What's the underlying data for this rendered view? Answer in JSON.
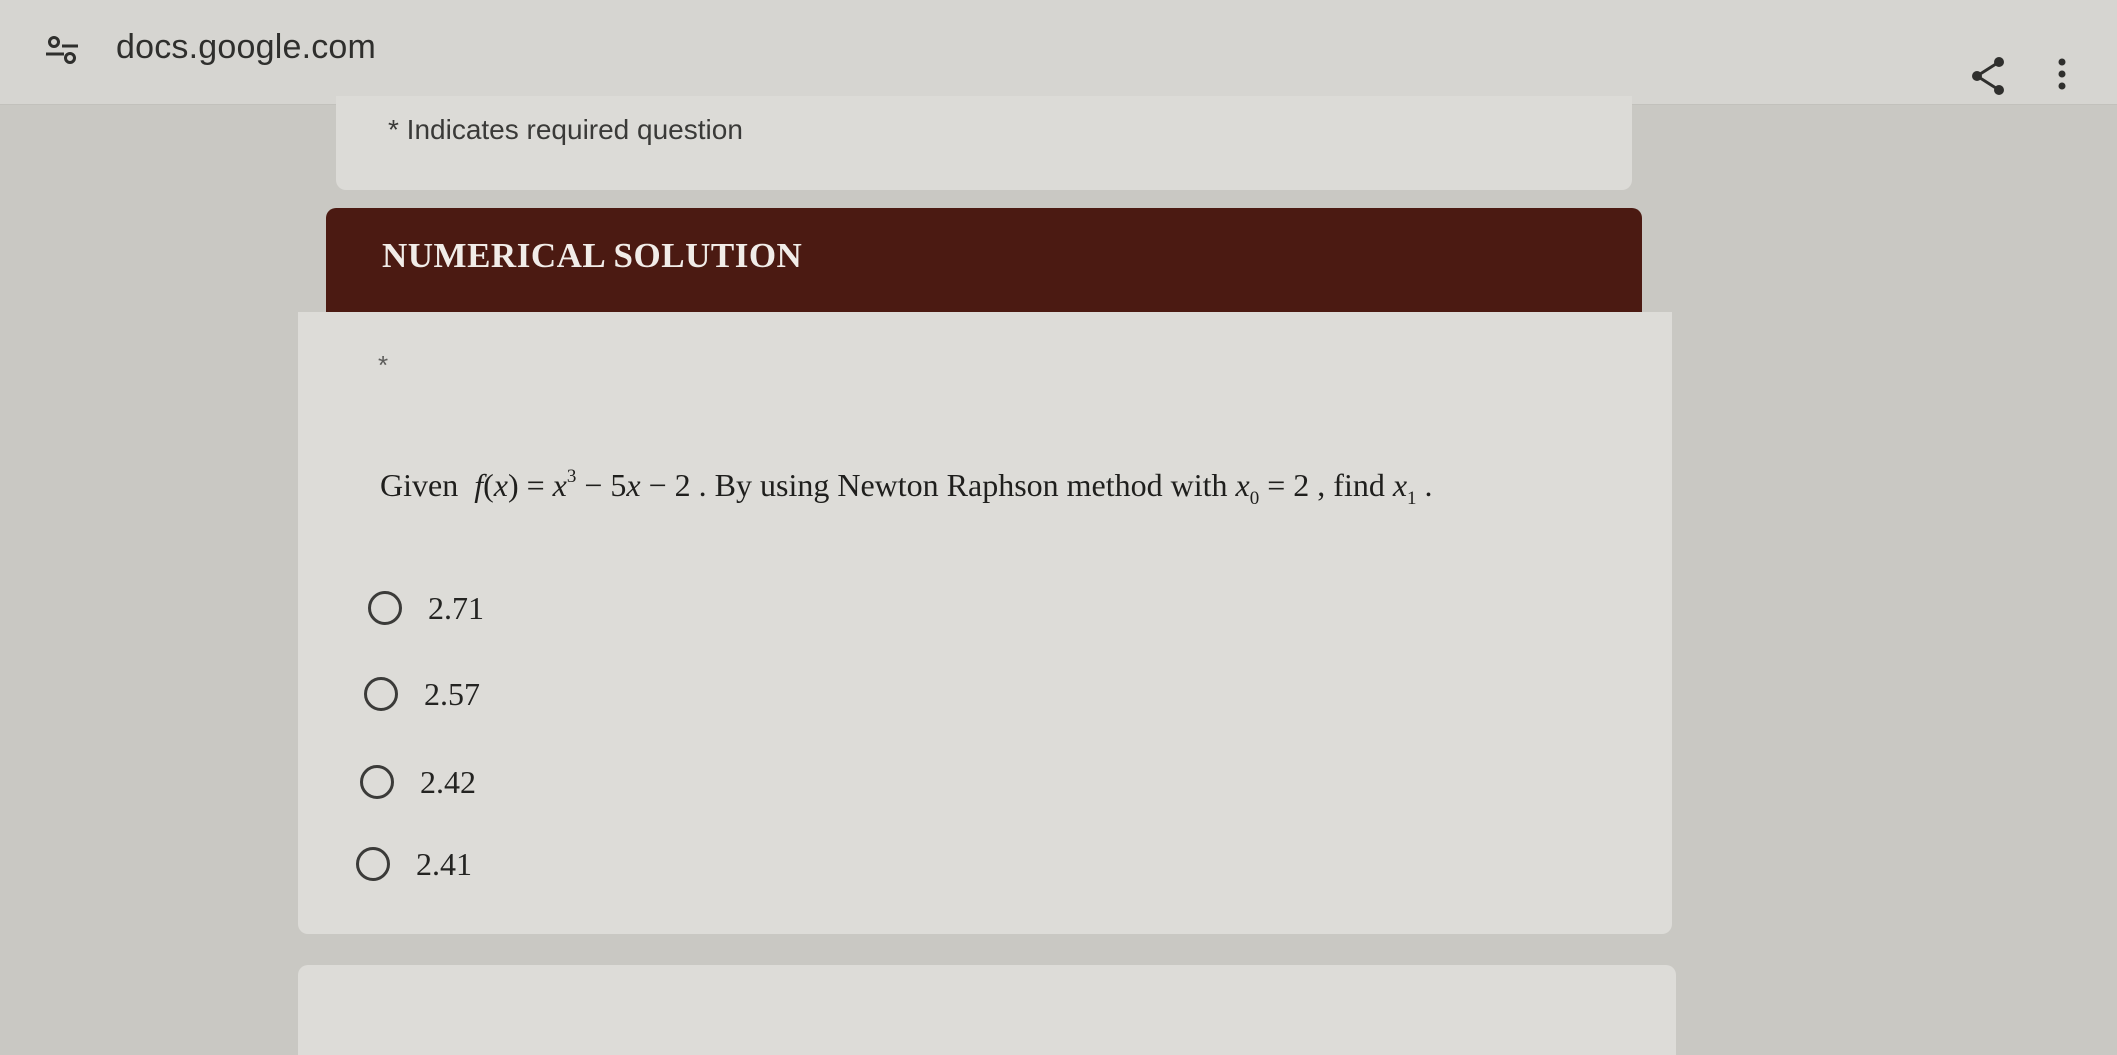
{
  "browser": {
    "url": "docs.google.com",
    "site_info_icon": "site-info-tune-icon",
    "share_icon": "share-icon",
    "menu_icon": "more-vert-icon"
  },
  "form": {
    "required_note": "* Indicates required question",
    "section_title": "NUMERICAL SOLUTION",
    "question": {
      "required_marker": "*",
      "text_prefix": "Given",
      "fx_f": "f",
      "fx_open": "(",
      "fx_x": "x",
      "fx_close": ")",
      "fx_eq": " = ",
      "fx_x3": "x",
      "fx_exp": "3",
      "fx_rest_minus": " − 5",
      "fx_rest_x": "x",
      "fx_rest_tail": " − 2",
      "text_middle": " . By using Newton Raphson method with ",
      "x0_base": "x",
      "x0_sub": "0",
      "x0_eq": " = 2",
      "text_find": " , find ",
      "x1_base": "x",
      "x1_sub": "1",
      "text_end": " ."
    },
    "options": [
      {
        "label": "2.71",
        "selected": false
      },
      {
        "label": "2.57",
        "selected": false
      },
      {
        "label": "2.42",
        "selected": false
      },
      {
        "label": "2.41",
        "selected": false
      }
    ]
  },
  "colors": {
    "section_header_bg": "#4b1a12",
    "card_bg": "#dddcd8",
    "page_bg": "#c9c8c3"
  }
}
